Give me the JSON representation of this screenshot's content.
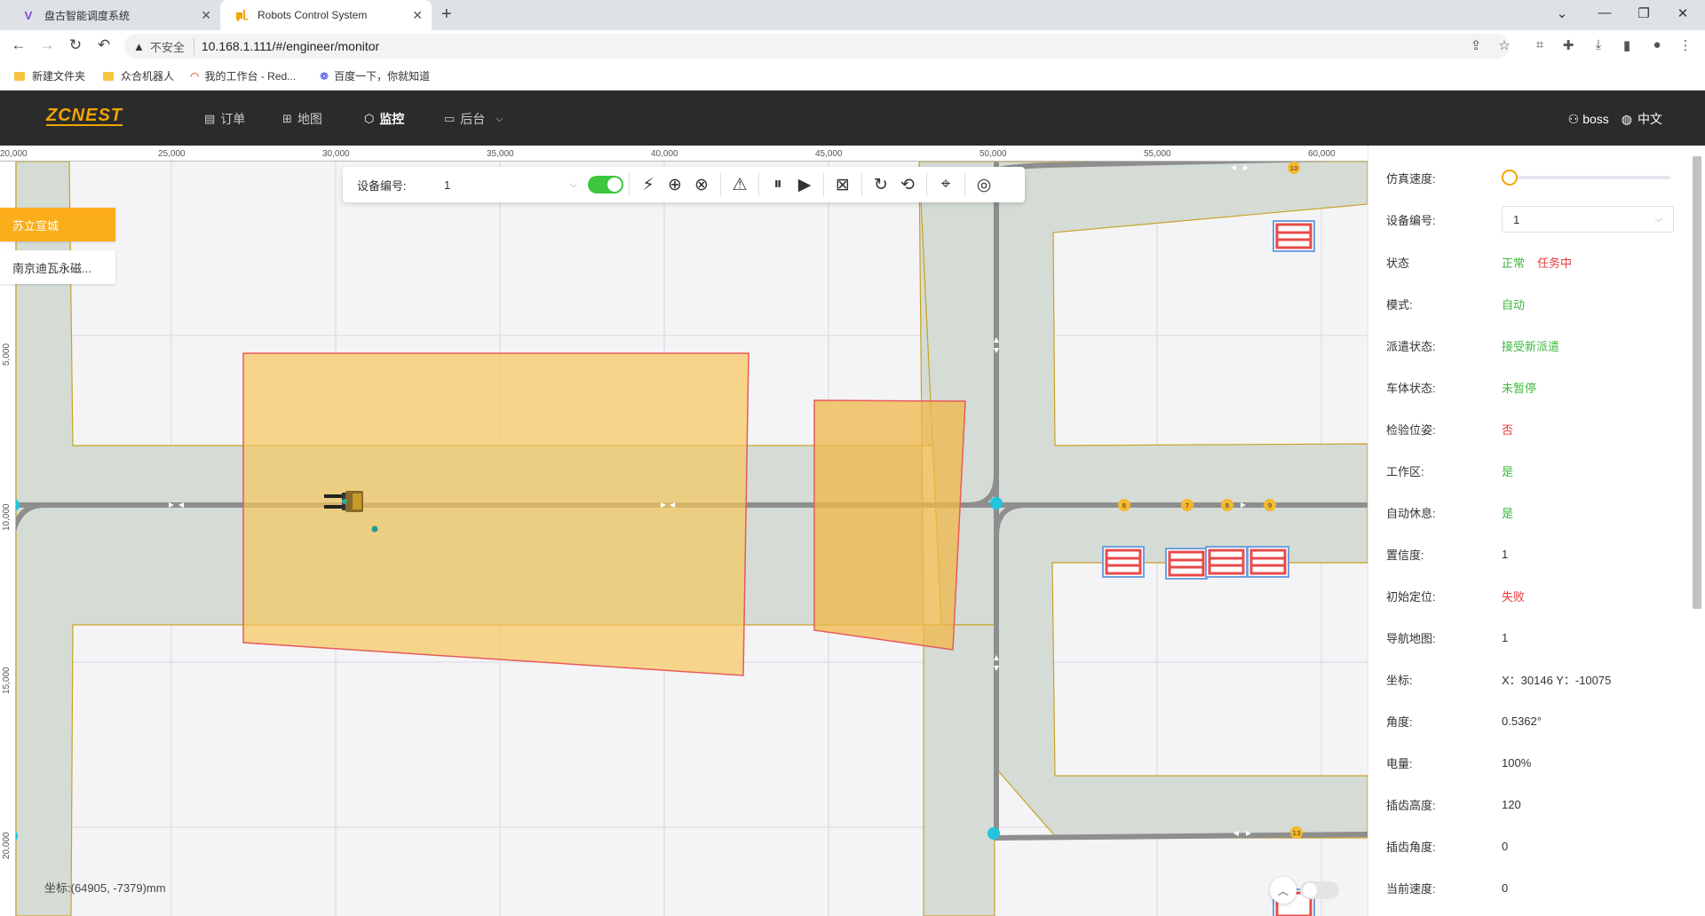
{
  "browser": {
    "tabs": [
      {
        "title": "盘古智能调度系统",
        "favicon": "V"
      },
      {
        "title": "Robots Control System",
        "favicon": "forklift"
      }
    ],
    "security_label": "不安全",
    "url": "10.168.1.111/#/engineer/monitor",
    "bookmarks": [
      "新建文件夹",
      "众合机器人",
      "我的工作台 - Red...",
      "百度一下，你就知道"
    ]
  },
  "header": {
    "logo": "ZCNEST",
    "nav": [
      {
        "label": "订单",
        "icon": "order-icon"
      },
      {
        "label": "地图",
        "icon": "map-icon"
      },
      {
        "label": "监控",
        "icon": "monitor-icon",
        "active": true
      },
      {
        "label": "后台",
        "icon": "desktop-icon"
      }
    ],
    "user": "boss",
    "language": "中文"
  },
  "map": {
    "ruler_top": [
      "20,000",
      "25,000",
      "30,000",
      "35,000",
      "40,000",
      "45,000",
      "50,000",
      "55,000",
      "60,000"
    ],
    "ruler_left": [
      "5,000",
      "10,000",
      "15,000",
      "20,000"
    ],
    "sites": [
      {
        "label": "苏立宣城",
        "active": true
      },
      {
        "label": "南京迪瓦永磁..."
      }
    ],
    "toolbar": {
      "device_label": "设备编号:",
      "device_value": "1"
    },
    "node_labels": [
      "10",
      "6",
      "7",
      "8",
      "9",
      "13"
    ],
    "coordinate": "坐标:(64905, -7379)mm"
  },
  "info": {
    "sim_speed_label": "仿真速度:",
    "sim_speed_fraction": 0,
    "rows": [
      {
        "label": "设备编号:",
        "value": "1",
        "type": "select"
      },
      {
        "label": "状态",
        "value": "正常",
        "value2": "任务中",
        "color": "green",
        "color2": "red"
      },
      {
        "label": "模式:",
        "value": "自动",
        "color": "green"
      },
      {
        "label": "派遣状态:",
        "value": "接受新派遣",
        "color": "green"
      },
      {
        "label": "车体状态:",
        "value": "未暂停",
        "color": "green"
      },
      {
        "label": "检验位姿:",
        "value": "否",
        "color": "red"
      },
      {
        "label": "工作区:",
        "value": "是",
        "color": "green"
      },
      {
        "label": "自动休息:",
        "value": "是",
        "color": "green"
      },
      {
        "label": "置信度:",
        "value": "1"
      },
      {
        "label": "初始定位:",
        "value": "失败",
        "color": "red"
      },
      {
        "label": "导航地图:",
        "value": "1"
      },
      {
        "label": "坐标:",
        "value": "X：30146 Y：-10075"
      },
      {
        "label": "角度:",
        "value": "0.5362°"
      },
      {
        "label": "电量:",
        "value": "100%"
      },
      {
        "label": "插齿高度:",
        "value": "120"
      },
      {
        "label": "插齿角度:",
        "value": "0"
      },
      {
        "label": "当前速度:",
        "value": "0"
      }
    ]
  },
  "colors": {
    "accent": "#fbad1a",
    "ok": "#3db83d",
    "alert": "#e83a3a",
    "zone_fill": "#f7c75e",
    "lane_fill": "#d4dcd5",
    "header_bg": "#2b2b2b"
  }
}
